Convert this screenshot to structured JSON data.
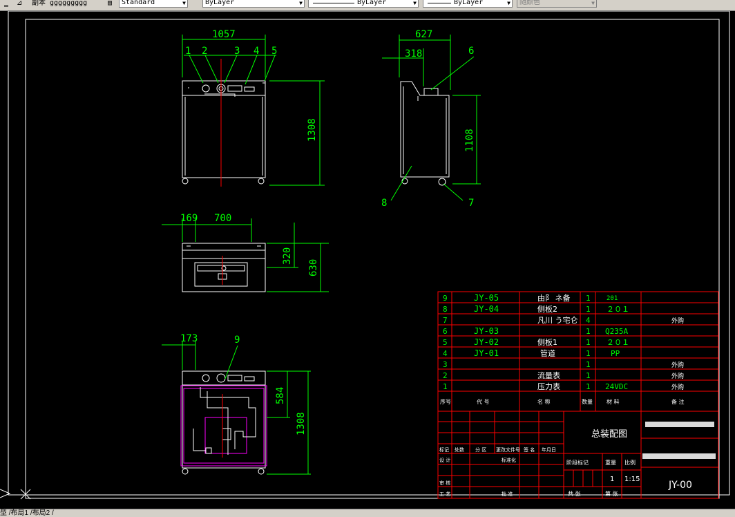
{
  "toolbar": {
    "layer_text": "副本 ggggggggg",
    "textstyle": "Standard",
    "layer": "ByLayer",
    "linetype": "ByLayer",
    "lineweight": "ByLayer",
    "plotstyle": "随颜色"
  },
  "layout_tabs": "型 /布局1 /布局2 /",
  "drawing": {
    "dims": {
      "front_width": "1057",
      "front_height": "1308",
      "side_width": "627",
      "side_offset": "318",
      "side_height": "1108",
      "top_offset": "169",
      "top_width": "700",
      "top_depth_1": "320",
      "top_depth_2": "630",
      "sec_offset": "173",
      "sec_height_1": "584",
      "sec_height_2": "1308"
    },
    "balloons": [
      "1",
      "2",
      "3",
      "4",
      "5",
      "6",
      "7",
      "8",
      "9"
    ]
  },
  "bom": {
    "rows": [
      {
        "no": "9",
        "code": "JY-05",
        "name": "由阝 ネ备",
        "qty": "1",
        "material": "201",
        "note": ""
      },
      {
        "no": "8",
        "code": "JY-04",
        "name": "侧板2",
        "qty": "1",
        "material": "２０１",
        "note": ""
      },
      {
        "no": "7",
        "code": "",
        "name": "凡川 う宅仑",
        "qty": "4",
        "material": "",
        "note": "外购"
      },
      {
        "no": "6",
        "code": "JY-03",
        "name": "",
        "qty": "1",
        "material": "Q235A",
        "note": ""
      },
      {
        "no": "5",
        "code": "JY-02",
        "name": "侧板1",
        "qty": "1",
        "material": "２０１",
        "note": ""
      },
      {
        "no": "4",
        "code": "JY-01",
        "name": "管道",
        "qty": "1",
        "material": "PP",
        "note": ""
      },
      {
        "no": "3",
        "code": "",
        "name": "",
        "qty": "1",
        "material": "",
        "note": "外购"
      },
      {
        "no": "2",
        "code": "",
        "name": "流量表",
        "qty": "1",
        "material": "",
        "note": "外购"
      },
      {
        "no": "1",
        "code": "",
        "name": "压力表",
        "qty": "1",
        "material": "24VDC",
        "note": "外购"
      }
    ],
    "header": {
      "no": "序号",
      "code": "代 号",
      "name": "名 称",
      "qty": "数量",
      "material": "材 料",
      "note": "备 注"
    }
  },
  "title_block": {
    "drawing_name": "总装配图",
    "drawing_no": "JY-00",
    "scale": "1:15",
    "qty": "1",
    "labels": {
      "mark": "标记",
      "count": "处数",
      "zone": "分 区",
      "change_doc": "更改文件号",
      "sign": "签 名",
      "date": "年月日",
      "design": "设 计",
      "standard": "标准化",
      "review": "审 核",
      "process": "工 艺",
      "approve": "批 准",
      "stage_mark": "阶段标记",
      "weight": "重量",
      "scale_lbl": "比例",
      "sheets_total": "共 张",
      "sheet": "第 张"
    }
  }
}
